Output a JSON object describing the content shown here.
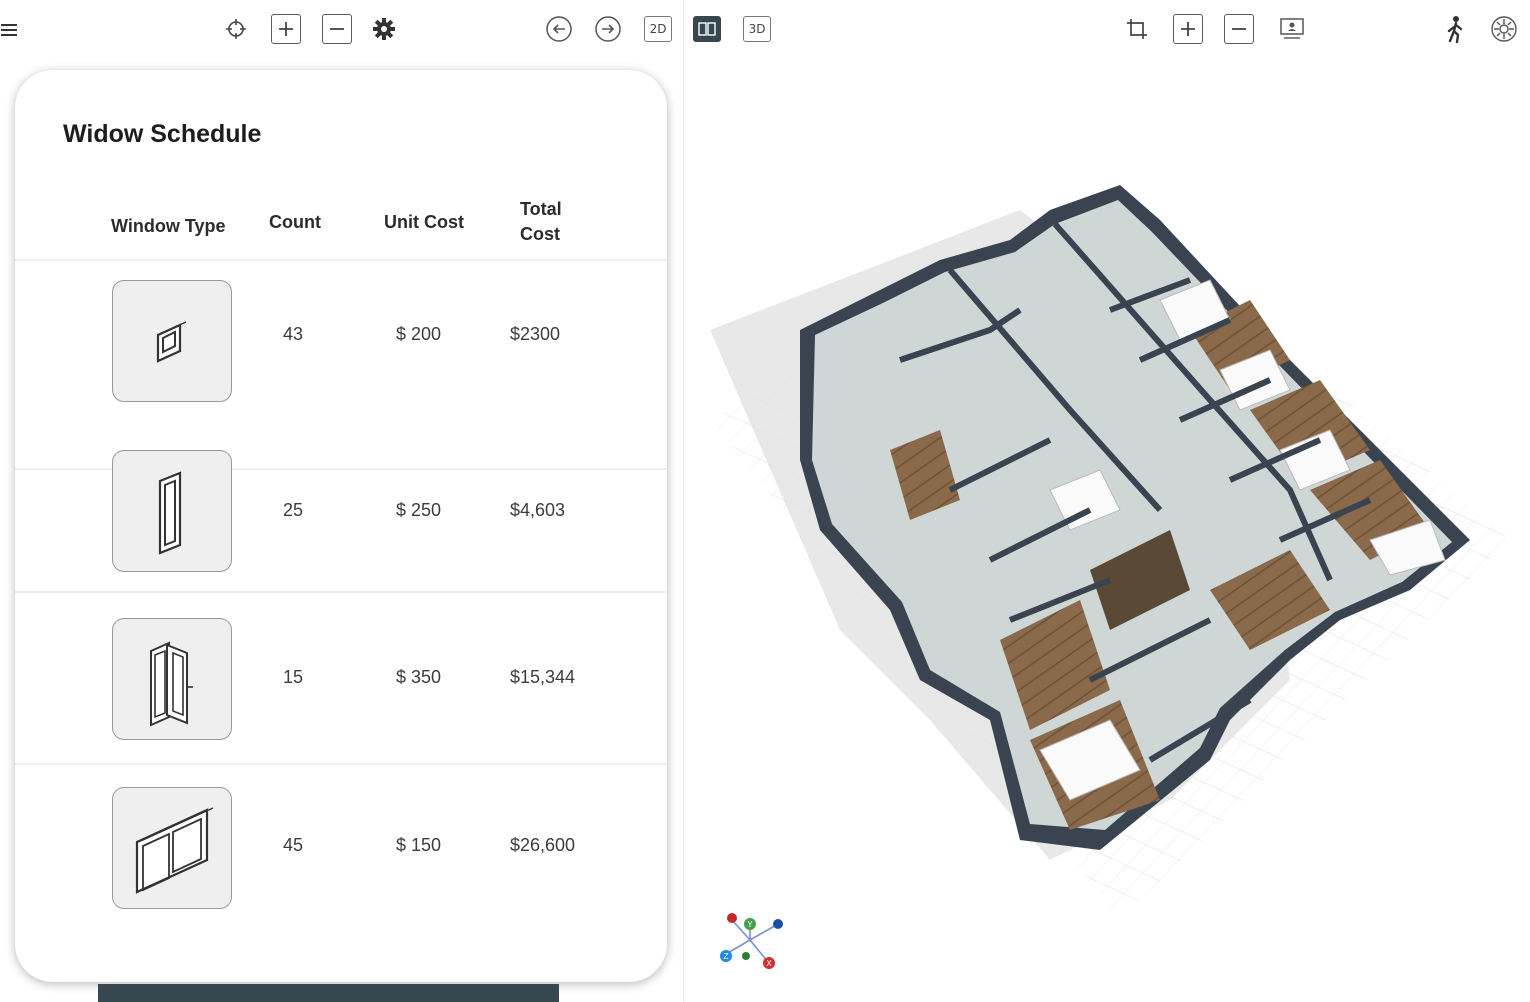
{
  "schedule": {
    "title": "Widow Schedule",
    "columns": {
      "type": "Window Type",
      "count": "Count",
      "unit_cost": "Unit Cost",
      "total_line1": "Total",
      "total_line2": "Cost"
    },
    "rows": [
      {
        "icon": "small-square-window-icon",
        "count": "43",
        "unit_cost": "$ 200",
        "total_cost": "$2300"
      },
      {
        "icon": "tall-narrow-window-icon",
        "count": "25",
        "unit_cost": "$ 250",
        "total_cost": "$4,603"
      },
      {
        "icon": "casement-window-icon",
        "count": "15",
        "unit_cost": "$ 350",
        "total_cost": "$15,344"
      },
      {
        "icon": "sliding-window-icon",
        "count": "45",
        "unit_cost": "$ 150",
        "total_cost": "$26,600"
      }
    ]
  },
  "toolbar": {
    "view_2d_label": "2D",
    "view_3d_label": "3D",
    "icons_left": [
      "menu-icon",
      "crosshair-icon",
      "zoom-in-icon",
      "zoom-out-icon",
      "settings-icon",
      "undo-icon",
      "redo-icon"
    ],
    "icons_right": [
      "crop-icon",
      "zoom-in-icon",
      "zoom-out-icon",
      "presentation-icon",
      "walk-icon",
      "sun-icon"
    ]
  },
  "axes": {
    "y_label": "Y",
    "x_label": "X",
    "z_label": "Z"
  },
  "colors": {
    "accent_dark": "#37474f",
    "axis_x": "#d32f2f",
    "axis_y": "#43a047",
    "axis_z": "#1e88e5"
  }
}
